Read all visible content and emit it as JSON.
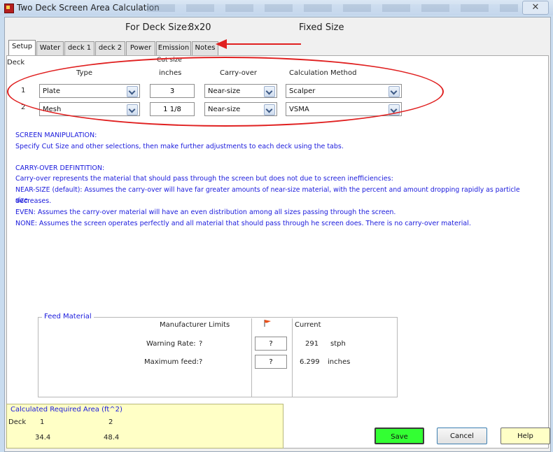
{
  "window": {
    "title": "Two Deck Screen Area Calculation",
    "close_label": "✕"
  },
  "header": {
    "deck_size_label": "For Deck Size:",
    "deck_size_value": "8x20",
    "mode": "Fixed Size"
  },
  "tabs": [
    "Setup",
    "Water",
    "deck 1",
    "deck 2",
    "Power",
    "Emission",
    "Notes"
  ],
  "setup": {
    "deck_label": "Deck",
    "columns": {
      "type": "Type",
      "cut_size": "Cut size",
      "cut_size_unit": "inches",
      "carry_over": "Carry-over",
      "calc_method": "Calculation Method"
    },
    "rows": [
      {
        "deck": "1",
        "type": "Plate",
        "cut_size": "3",
        "carry_over": "Near-size",
        "method": "Scalper"
      },
      {
        "deck": "2",
        "type": "Mesh",
        "cut_size": "1 1/8",
        "carry_over": "Near-size",
        "method": "VSMA"
      }
    ]
  },
  "info": {
    "screen_manip_title": "SCREEN MANIPULATION:",
    "screen_manip_text": "Specify Cut Size and other selections, then make further adjustments to each deck using the tabs.",
    "carry_over_title": "CARRY-OVER DEFINTITION:",
    "carry_over_text": "Carry-over represents the material that should pass through the screen but does not due to screen inefficiencies:",
    "near_size_text": "NEAR-SIZE (default): Assumes the carry-over will have far greater amounts of near-size material, with the percent and amount dropping rapidly as particle size",
    "near_size_cont": "decreases.",
    "even_text": "EVEN: Assumes the carry-over material will have an even distribution among all sizes passing through the screen.",
    "none_text": "NONE: Assumes the screen operates perfectly and all material that should pass through he screen does. There is no carry-over material."
  },
  "feed": {
    "title": "Feed Material",
    "mfr_limits": "Manufacturer Limits",
    "current": "Current",
    "warning_rate_label": "Warning Rate:",
    "warning_rate_limit": "?",
    "warning_rate_input": "?",
    "warning_rate_current": "291",
    "warning_rate_unit": "stph",
    "max_feed_label": "Maximum feed:",
    "max_feed_limit": "?",
    "max_feed_input": "?",
    "max_feed_current": "6.299",
    "max_feed_unit": "inches"
  },
  "area": {
    "title": "Calculated Required Area (ft^2)",
    "deck_label": "Deck",
    "deck1": "1",
    "deck2": "2",
    "value1": "34.4",
    "value2": "48.4"
  },
  "buttons": {
    "save": "Save",
    "cancel": "Cancel",
    "help": "Help"
  },
  "colors": {
    "save_button": "#33ff33",
    "help_button": "#ffffc6",
    "annotation": "#e02020",
    "info_text": "#1a1adc"
  }
}
